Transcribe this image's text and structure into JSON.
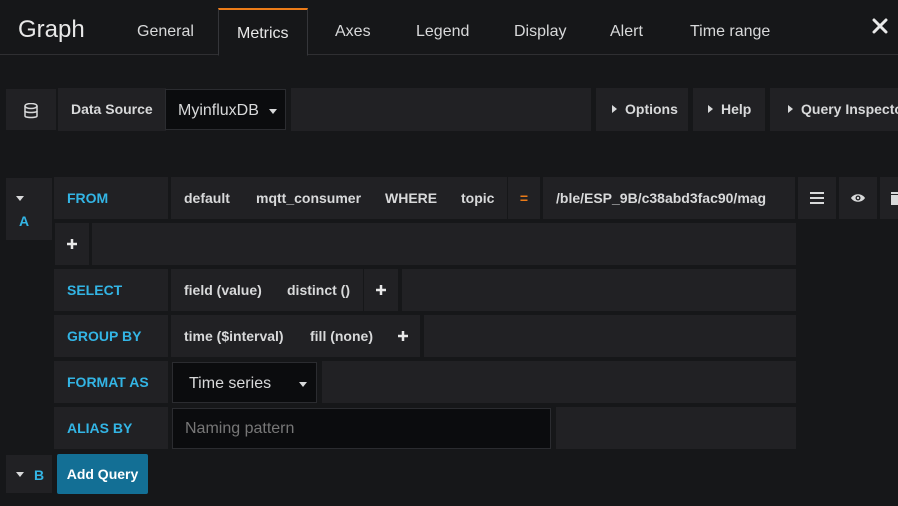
{
  "header": {
    "title": "Graph",
    "tabs": [
      "General",
      "Metrics",
      "Axes",
      "Legend",
      "Display",
      "Alert",
      "Time range"
    ],
    "active_tab": "Metrics"
  },
  "datasource": {
    "label": "Data Source",
    "value": "MyinfluxDB",
    "options_label": "Options",
    "help_label": "Help",
    "inspector_label": "Query Inspector"
  },
  "query_a": {
    "letter": "A",
    "from_keyword": "FROM",
    "policy": "default",
    "measurement": "mqtt_consumer",
    "where_keyword": "WHERE",
    "tag_key": "topic",
    "operator": "=",
    "tag_value": "/ble/ESP_9B/c38abd3fac90/mag",
    "select_keyword": "SELECT",
    "select_field": "field (value)",
    "select_func": "distinct ()",
    "group_keyword": "GROUP BY",
    "group_time": "time ($interval)",
    "group_fill": "fill (none)",
    "format_keyword": "FORMAT AS",
    "format_value": "Time series",
    "alias_keyword": "ALIAS BY",
    "alias_placeholder": "Naming pattern"
  },
  "query_b": {
    "letter": "B",
    "add_query_label": "Add Query"
  },
  "colors": {
    "accent_orange": "#eb7b18",
    "keyword_blue": "#33b5e5",
    "primary_button": "#136f95",
    "background": "#161719",
    "panel": "#212124"
  }
}
